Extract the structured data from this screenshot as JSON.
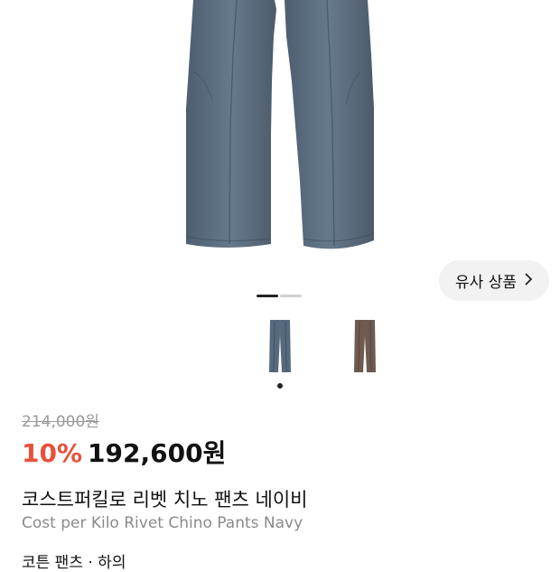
{
  "product": {
    "similar_label": "유사 상품",
    "original_price": "214,000원",
    "discount": "10%",
    "price": "192,600원",
    "name_ko": "코스트퍼킬로 리벳 치노 팬츠 네이비",
    "name_en": "Cost per Kilo Rivet Chino Pants Navy",
    "category": "코튼 팬츠 · 하의"
  },
  "carousel": {
    "active_index": 0,
    "count": 2
  },
  "thumbnails": [
    {
      "name": "navy",
      "color": "#566a7e"
    },
    {
      "name": "brown",
      "color": "#6e5a4f"
    }
  ],
  "colors": {
    "accent": "#e9503b",
    "pants_main": "#5f7387",
    "pants_shadow": "#4a5b6c"
  }
}
